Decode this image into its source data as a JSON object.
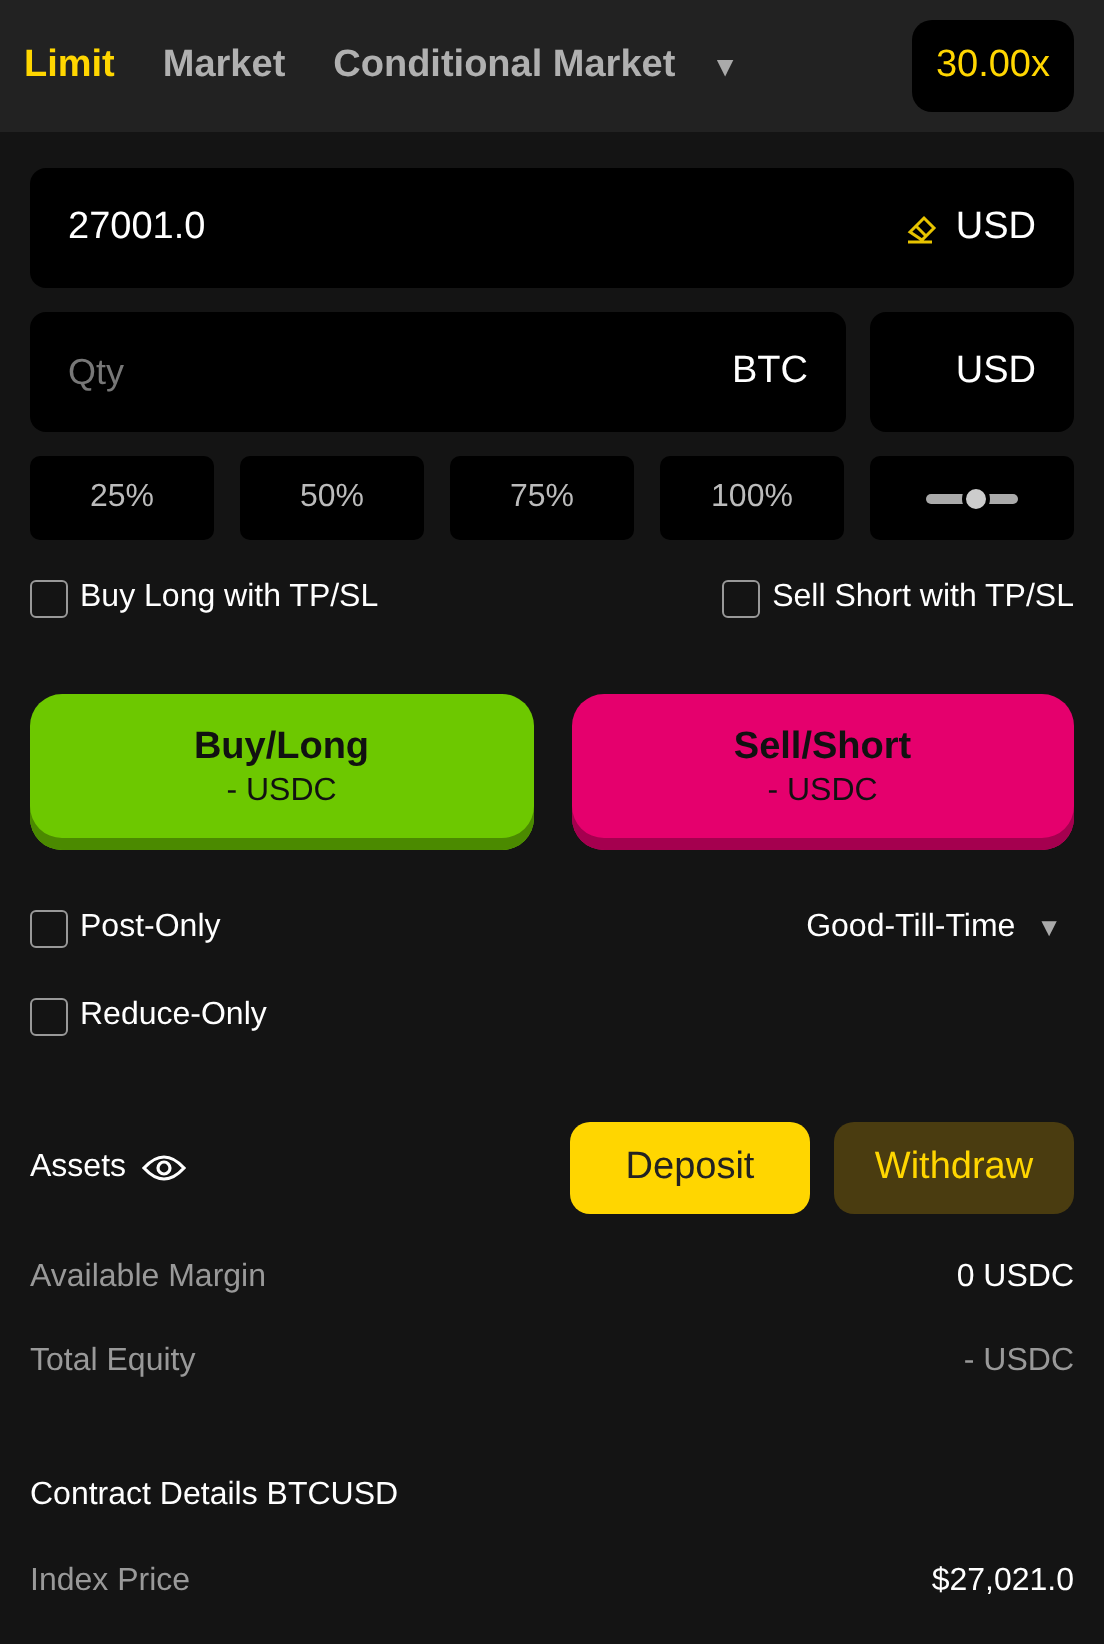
{
  "order_types": [
    {
      "label": "Limit",
      "selected": true
    },
    {
      "label": "Market",
      "selected": false
    },
    {
      "label": "Conditional Market",
      "selected": false
    }
  ],
  "dropdown_arrow": "▼",
  "leverage": "30.00x",
  "price_field": {
    "value": "27001.0",
    "unit": "USD"
  },
  "qty_field": {
    "placeholder": "Qty",
    "unit": "BTC"
  },
  "qty_unit_button": "USD",
  "percent_buttons": [
    "25%",
    "50%",
    "75%",
    "100%"
  ],
  "tpsl_options": [
    {
      "label": "Buy Long with TP/SL",
      "checked": false
    },
    {
      "label": "Sell Short with TP/SL",
      "checked": false
    }
  ],
  "actions": [
    {
      "kind": "buy",
      "label": "Buy/Long",
      "amount": "- USDC"
    },
    {
      "kind": "sell",
      "label": "Sell/Short",
      "amount": "- USDC"
    }
  ],
  "order_options": [
    {
      "label": "Post-Only",
      "checked": false
    },
    {
      "label": "Reduce-Only",
      "checked": false
    }
  ],
  "time_in_force": {
    "value": "Good-Till-Time",
    "arrow": "▼"
  },
  "assets": {
    "title": "Assets",
    "deposit": "Deposit",
    "withdraw": "Withdraw",
    "rows": [
      {
        "label": "Available Margin",
        "value": "0 USDC",
        "dimmed": false
      },
      {
        "label": "Total Equity",
        "value": "- USDC",
        "dimmed": true
      }
    ]
  },
  "contract": {
    "title": "Contract Details BTCUSD",
    "rows": [
      {
        "label": "Index Price",
        "value": "$27,021.0",
        "dimmed": false
      }
    ]
  }
}
